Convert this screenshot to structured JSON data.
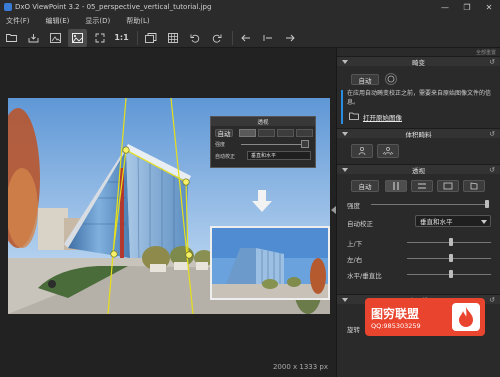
{
  "window": {
    "title": "DxO ViewPoint 3.2 - 05_perspective_vertical_tutorial.jpg",
    "controls": [
      "—",
      "❐",
      "✕"
    ]
  },
  "menu": [
    "文件(F)",
    "编辑(E)",
    "显示(D)",
    "帮助(L)"
  ],
  "toolbar": {
    "one_to_one": "1:1",
    "active": "fit-view"
  },
  "viewer": {
    "image_size": "2000 x 1333 px",
    "inset_panel": {
      "title": "透视",
      "auto_button": "自动",
      "intensity_label": "强度",
      "auto_correct_label": "自动校正",
      "auto_correct_value": "垂直和水平"
    }
  },
  "panel": {
    "header_hint": "全部重置",
    "sections": {
      "distortion": {
        "title": "畸变",
        "auto_button": "自动",
        "notice": "在应用自动畸变校正之前，需要来自原始图像文件的信息。",
        "open_original": "打开原始图像"
      },
      "volume": {
        "title": "体积畸料"
      },
      "perspective": {
        "title": "透视",
        "auto_button": "自动",
        "intensity_label": "强度",
        "auto_correct_label": "自动校正",
        "auto_correct_value": "垂直和水平",
        "up_down_label": "上/下",
        "left_right_label": "左/右",
        "ratio_label": "水平/垂直比"
      },
      "horizon": {
        "title": "水平线",
        "tilt_label": "旋转"
      }
    }
  },
  "watermark": {
    "main": "图穷联盟",
    "sub": "QQ:985303259",
    "accent": "#e8442e"
  },
  "colors": {
    "guide_lines": "#e6e01a",
    "accent_blue": "#2a8de0"
  }
}
